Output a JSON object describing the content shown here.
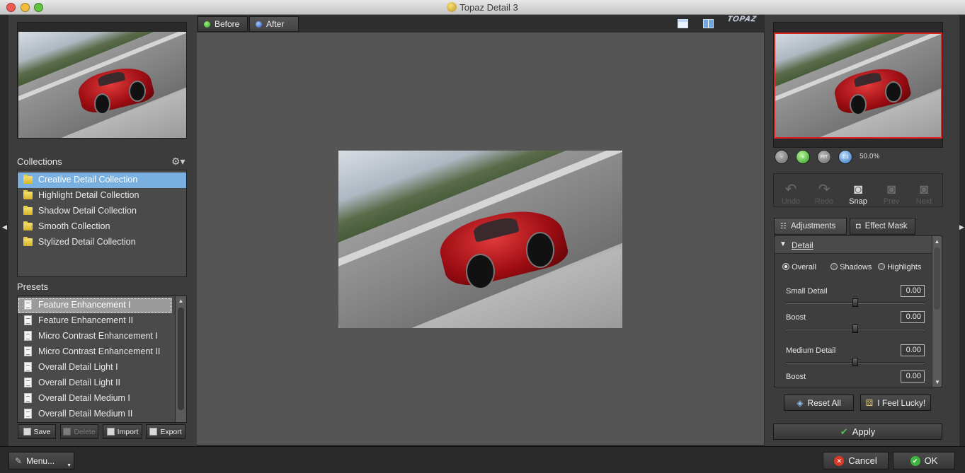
{
  "window": {
    "title": "Topaz Detail 3"
  },
  "view_tabs": {
    "before": "Before",
    "after": "After"
  },
  "logo_text": "TOPAZ",
  "collections": {
    "heading": "Collections",
    "items": [
      "Creative Detail Collection",
      "Highlight Detail Collection",
      "Shadow Detail Collection",
      "Smooth Collection",
      "Stylized Detail Collection"
    ],
    "selected_index": 0
  },
  "presets": {
    "heading": "Presets",
    "items": [
      "Feature Enhancement I",
      "Feature Enhancement II",
      "Micro Contrast Enhancement I",
      "Micro Contrast Enhancement II",
      "Overall Detail Light I",
      "Overall Detail Light II",
      "Overall Detail Medium I",
      "Overall Detail Medium II"
    ],
    "selected_index": 0,
    "buttons": {
      "save": "Save",
      "delete": "Delete",
      "import": "Import",
      "export": "Export"
    }
  },
  "navigator": {
    "zoom_level": "50.0%",
    "zoom_buttons": [
      "zoom-out",
      "zoom-in",
      "FIT",
      "1:1"
    ]
  },
  "history": {
    "undo": "Undo",
    "redo": "Redo",
    "snap": "Snap",
    "prev": "Prev",
    "next": "Next"
  },
  "right_tabs": {
    "adjustments": "Adjustments",
    "effect_mask": "Effect Mask"
  },
  "detail_section": {
    "title": "Detail",
    "modes": [
      "Overall",
      "Shadows",
      "Highlights"
    ],
    "selected_mode": "Overall",
    "sliders": [
      {
        "label": "Small Detail",
        "value": "0.00",
        "position": 0.5
      },
      {
        "label": "Boost",
        "value": "0.00",
        "position": 0.5
      },
      {
        "label": "Medium Detail",
        "value": "0.00",
        "position": 0.5
      },
      {
        "label": "Boost",
        "value": "0.00",
        "position": 0.5
      }
    ]
  },
  "actions": {
    "reset_all": "Reset All",
    "feel_lucky": "I Feel Lucky!",
    "apply": "Apply"
  },
  "bottom": {
    "menu": "Menu...",
    "cancel": "Cancel",
    "ok": "OK"
  },
  "colors": {
    "selection": "#79b0e0",
    "nav_frame": "#e01f1f",
    "ok_green": "#3fb53f",
    "cancel_red": "#d93a2a"
  }
}
